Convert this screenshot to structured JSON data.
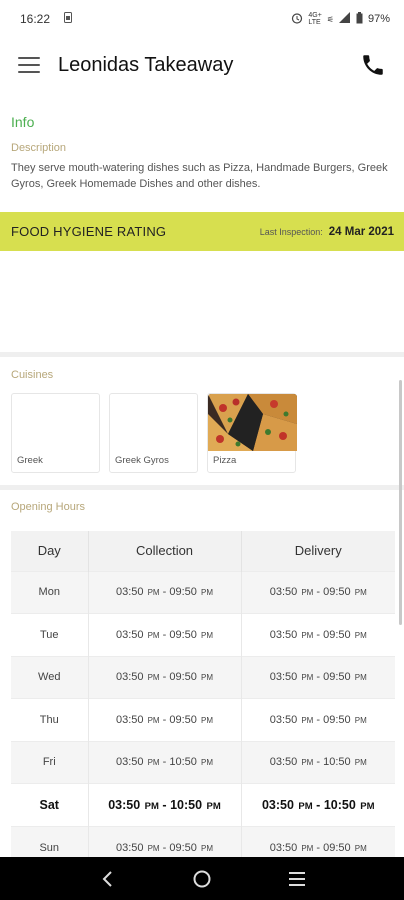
{
  "status_bar": {
    "time": "16:22",
    "battery": "97%",
    "icons": [
      "sim-icon",
      "alarm-icon",
      "4g-plus-icon",
      "wifi-calling-icon",
      "signal-icon",
      "battery-icon"
    ]
  },
  "app_bar": {
    "title": "Leonidas Takeaway",
    "menu_icon": "hamburger-menu-icon",
    "call_icon": "phone-icon"
  },
  "info": {
    "heading": "Info",
    "description_label": "Description",
    "description": "They serve mouth-watering dishes such as Pizza, Handmade Burgers, Greek Gyros, Greek Homemade Dishes and other dishes."
  },
  "hygiene": {
    "title": "FOOD HYGIENE RATING",
    "last_inspection_label": "Last Inspection:",
    "last_inspection_date": "24 Mar 2021"
  },
  "cuisines": {
    "label": "Cuisines",
    "items": [
      {
        "name": "Greek"
      },
      {
        "name": "Greek Gyros"
      },
      {
        "name": "Pizza"
      }
    ]
  },
  "opening_hours": {
    "label": "Opening Hours",
    "headers": [
      "Day",
      "Collection",
      "Delivery"
    ],
    "rows": [
      {
        "day": "Mon",
        "collection": {
          "from": "03:50",
          "to": "09:50"
        },
        "delivery": {
          "from": "03:50",
          "to": "09:50"
        }
      },
      {
        "day": "Tue",
        "collection": {
          "from": "03:50",
          "to": "09:50"
        },
        "delivery": {
          "from": "03:50",
          "to": "09:50"
        }
      },
      {
        "day": "Wed",
        "collection": {
          "from": "03:50",
          "to": "09:50"
        },
        "delivery": {
          "from": "03:50",
          "to": "09:50"
        }
      },
      {
        "day": "Thu",
        "collection": {
          "from": "03:50",
          "to": "09:50"
        },
        "delivery": {
          "from": "03:50",
          "to": "09:50"
        }
      },
      {
        "day": "Fri",
        "collection": {
          "from": "03:50",
          "to": "10:50"
        },
        "delivery": {
          "from": "03:50",
          "to": "10:50"
        }
      },
      {
        "day": "Sat",
        "collection": {
          "from": "03:50",
          "to": "10:50"
        },
        "delivery": {
          "from": "03:50",
          "to": "10:50"
        }
      },
      {
        "day": "Sun",
        "collection": {
          "from": "03:50",
          "to": "09:50"
        },
        "delivery": {
          "from": "03:50",
          "to": "09:50"
        }
      }
    ],
    "ampm": "PM",
    "separator": "-"
  },
  "colors": {
    "accent_green": "#4caf50",
    "hygiene_bar": "#d7df4f",
    "section_label": "#b7a77a"
  },
  "nav_bar": {
    "icons": [
      "back-icon",
      "home-icon",
      "recents-icon"
    ]
  }
}
